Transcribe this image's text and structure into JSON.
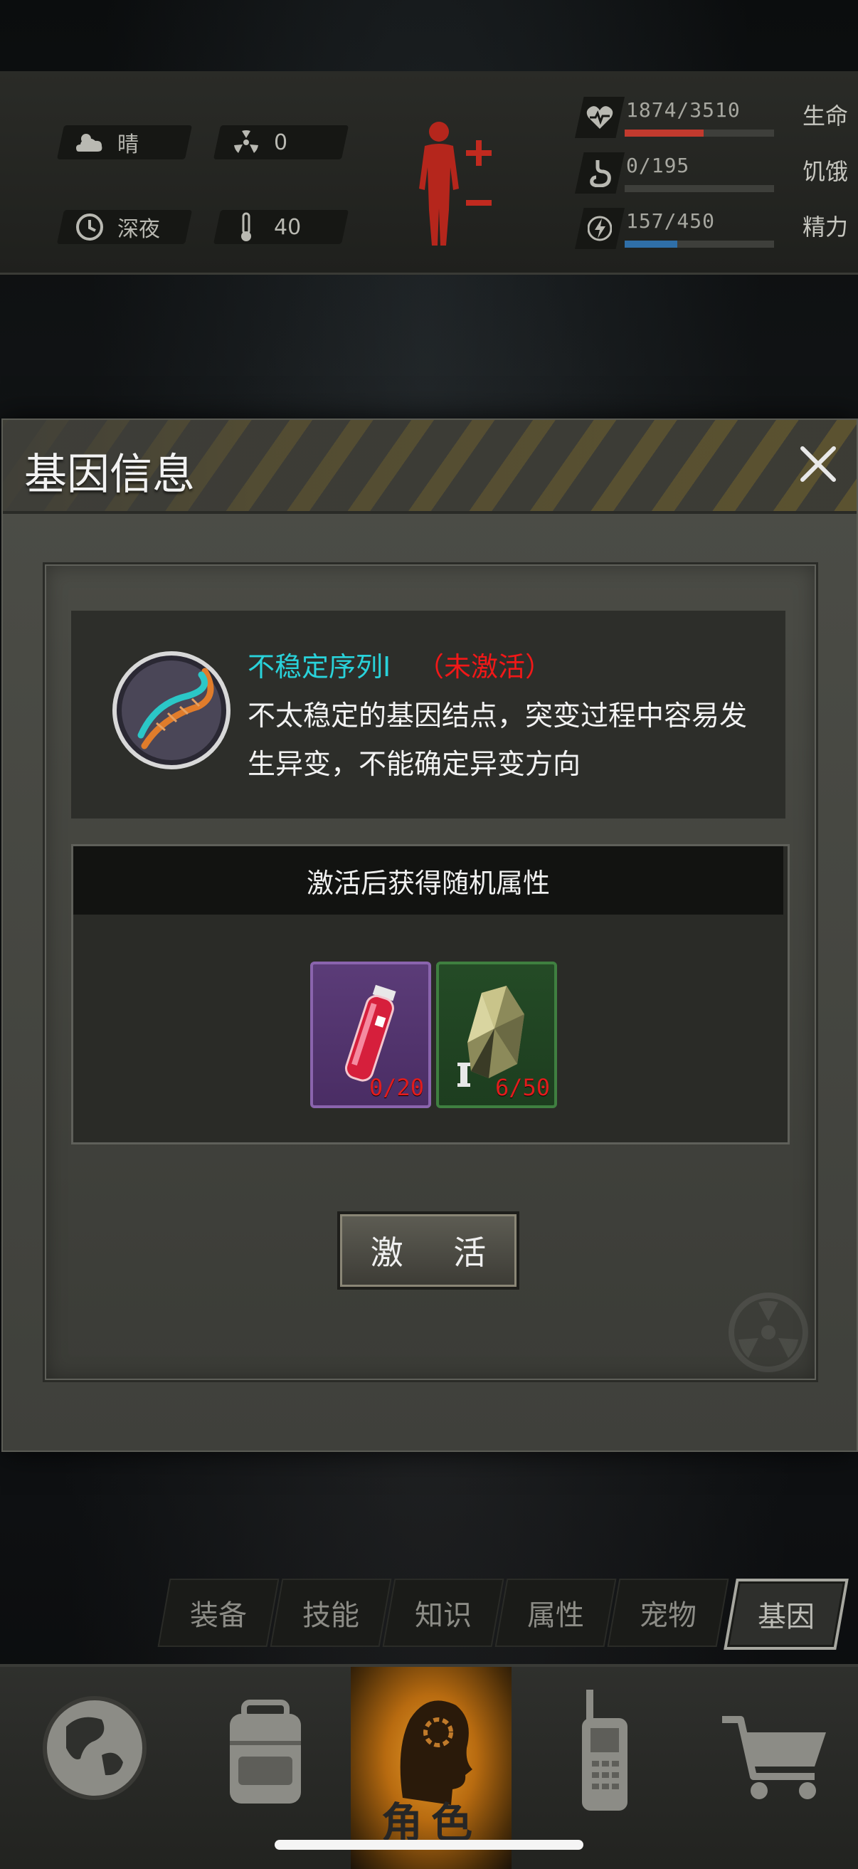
{
  "hud": {
    "weather": "晴",
    "radiation": "0",
    "time_of_day": "深夜",
    "temperature": "40",
    "stats": [
      {
        "value": "1874/3510",
        "label": "生命",
        "fill_fraction": 0.53,
        "color": "#c23a2e"
      },
      {
        "value": "0/195",
        "label": "饥饿",
        "fill_fraction": 0.0,
        "color": "#6b6b66"
      },
      {
        "value": "157/450",
        "label": "精力",
        "fill_fraction": 0.35,
        "color": "#2f6fa8"
      }
    ]
  },
  "dialog": {
    "title": "基因信息",
    "gene_name": "不稳定序列Ⅰ",
    "gene_status": "（未激活）",
    "gene_description": "不太稳定的基因结点，突变过程中容易发生异变，不能确定异变方向",
    "attr_header": "激活后获得随机属性",
    "items": [
      {
        "icon": "red-vial-icon",
        "count": "0/20",
        "rarity_color": "#8a64ad"
      },
      {
        "icon": "ore-crystal-icon",
        "count": "6/50",
        "rarity_color": "#3f7f40"
      }
    ],
    "activate_label": "激 活"
  },
  "tabs": [
    "装备",
    "技能",
    "知识",
    "属性",
    "宠物",
    "基因"
  ],
  "active_tab": "基因",
  "bottom_nav": {
    "items": [
      "world-globe-icon",
      "backpack-icon",
      "character-head-icon",
      "walkie-talkie-icon",
      "shopping-cart-icon"
    ],
    "active_label": "角色"
  }
}
